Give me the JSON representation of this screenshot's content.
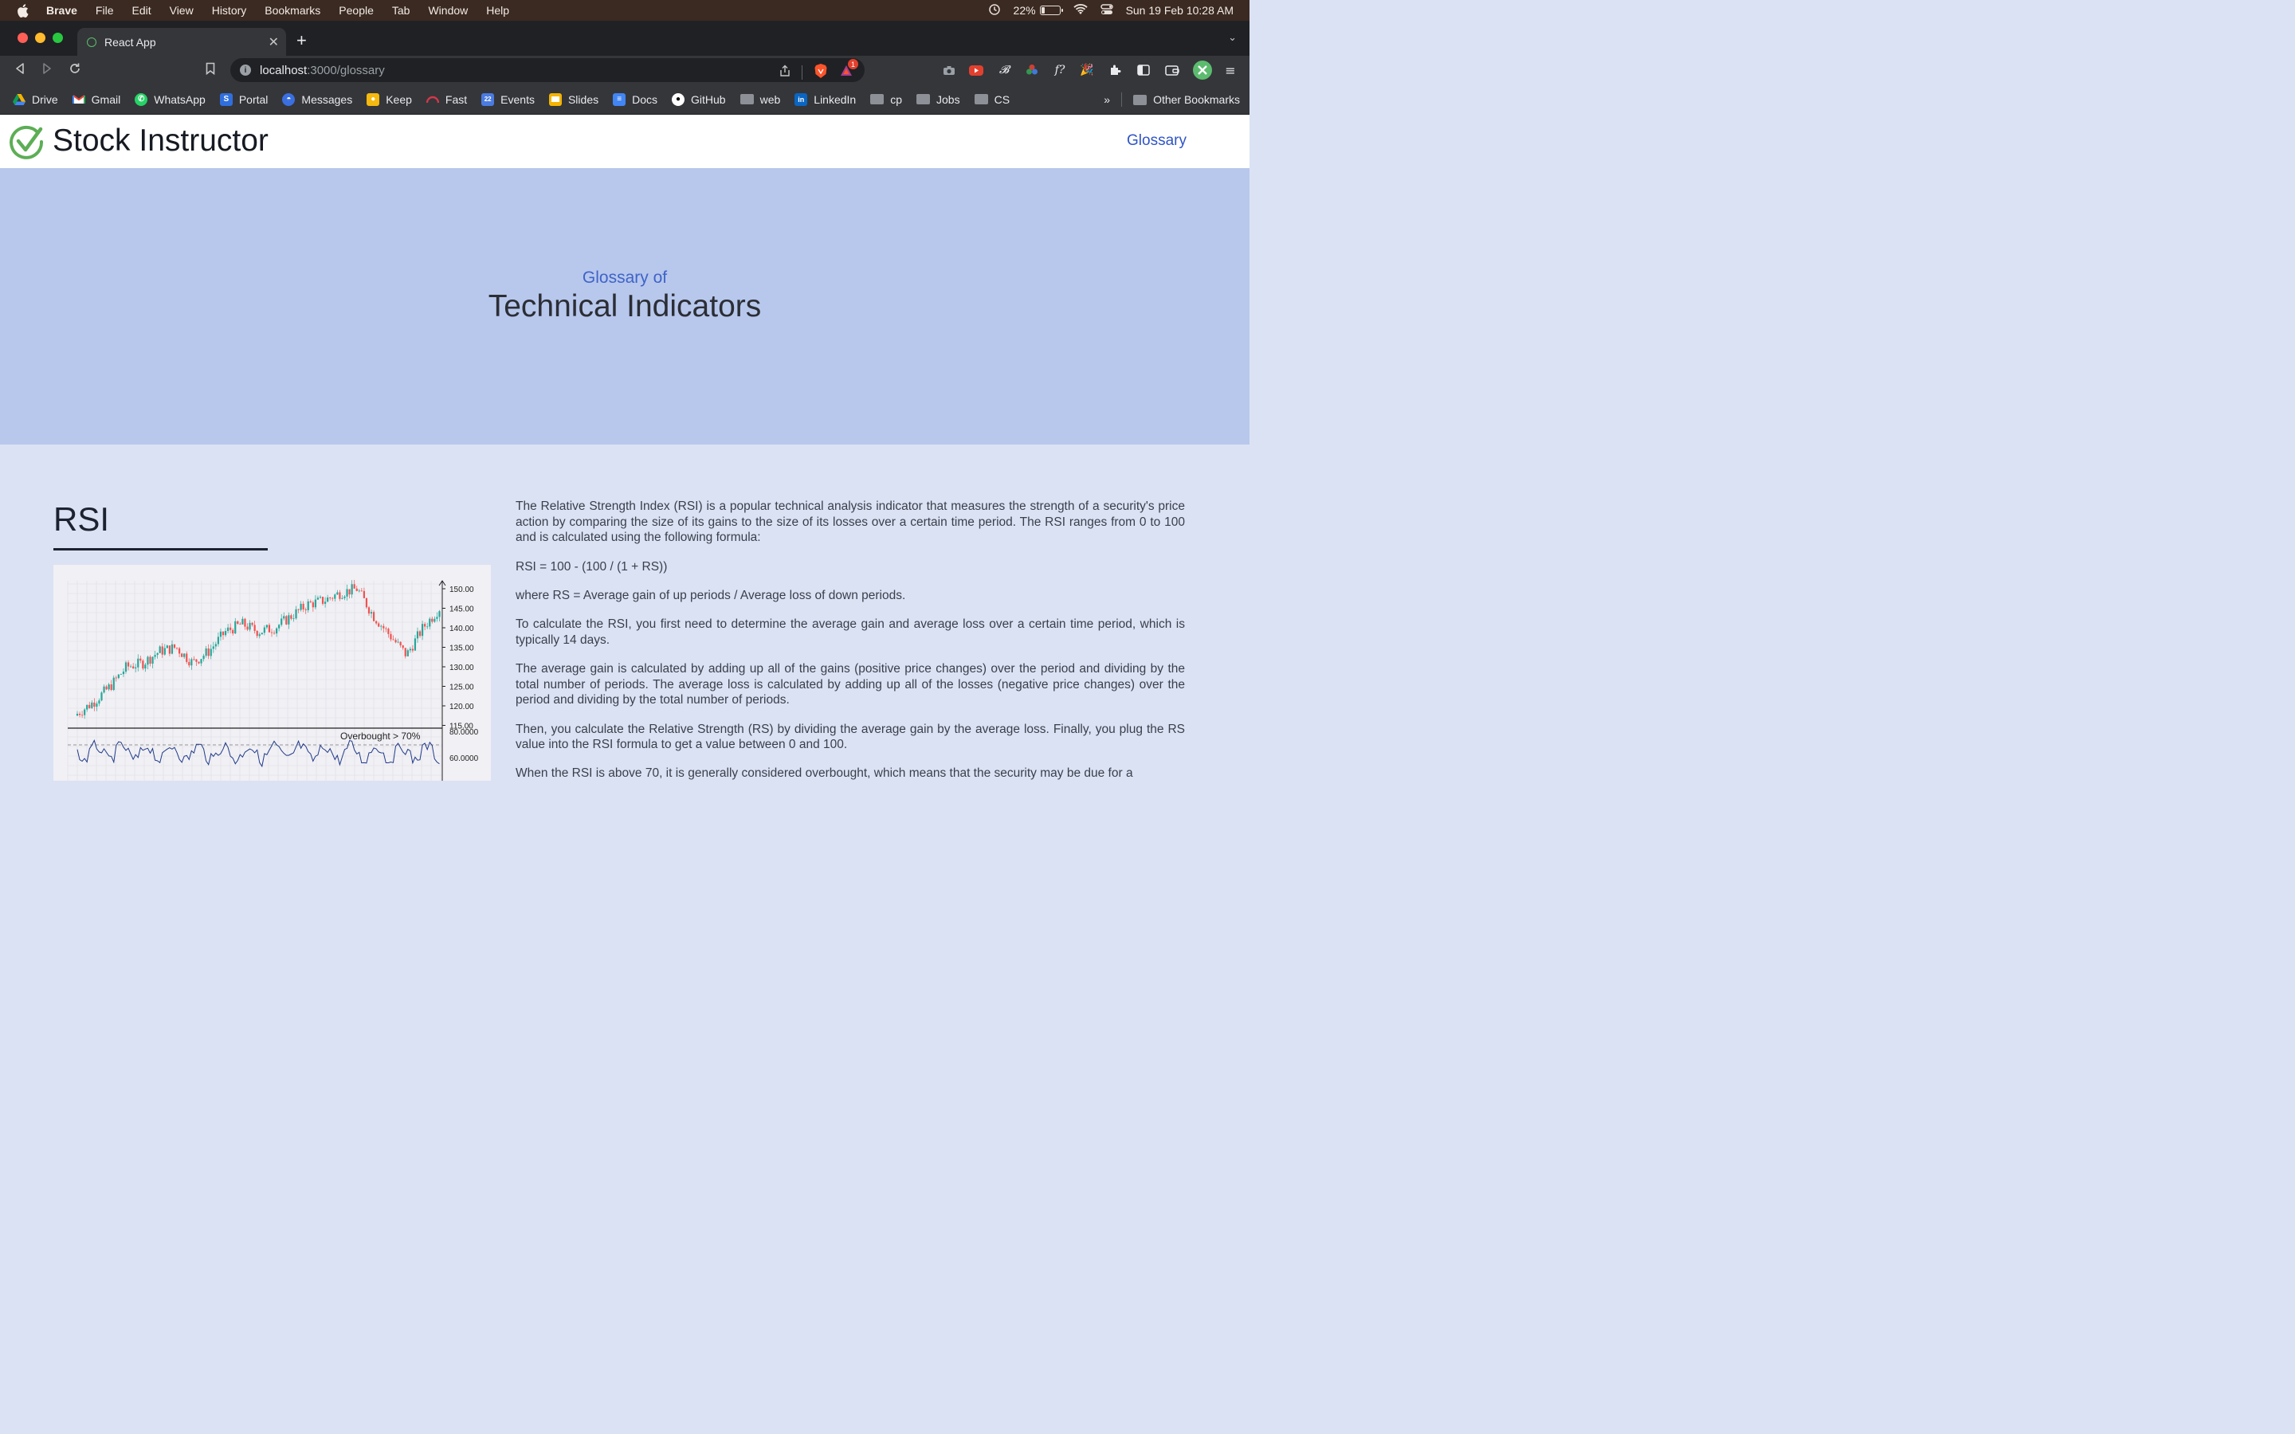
{
  "menubar": {
    "items": [
      "Brave",
      "File",
      "Edit",
      "View",
      "History",
      "Bookmarks",
      "People",
      "Tab",
      "Window",
      "Help"
    ],
    "battery_text": "22%",
    "battery_level": 0.22,
    "datetime": "Sun 19 Feb  10:28 AM",
    "icons": [
      "apple-icon",
      "time-machine-icon",
      "battery-icon",
      "wifi-icon",
      "control-center-icon"
    ]
  },
  "browser": {
    "tab_title": "React App",
    "url_host": "localhost",
    "url_path": ":3000/glossary",
    "shield_badge": "1",
    "bookmarks": [
      {
        "label": "Drive",
        "icon": "drive-icon",
        "color": "#f4b400"
      },
      {
        "label": "Gmail",
        "icon": "gmail-icon",
        "color": "#ea4335"
      },
      {
        "label": "WhatsApp",
        "icon": "whatsapp-icon",
        "color": "#25d366"
      },
      {
        "label": "Portal",
        "icon": "portal-icon",
        "color": "#2f6fde"
      },
      {
        "label": "Messages",
        "icon": "messages-icon",
        "color": "#3a6fe0"
      },
      {
        "label": "Keep",
        "icon": "keep-icon",
        "color": "#f5b90f"
      },
      {
        "label": "Fast",
        "icon": "fast-icon",
        "color": "#d2384a"
      },
      {
        "label": "Events",
        "icon": "calendar-icon",
        "color": "#4a7be0"
      },
      {
        "label": "Slides",
        "icon": "slides-icon",
        "color": "#f4b400"
      },
      {
        "label": "Docs",
        "icon": "docs-icon",
        "color": "#4285f4"
      },
      {
        "label": "GitHub",
        "icon": "github-icon",
        "color": "#ffffff"
      },
      {
        "label": "web",
        "icon": "folder-icon",
        "color": "#8d9096"
      },
      {
        "label": "LinkedIn",
        "icon": "linkedin-icon",
        "color": "#0a66c2"
      },
      {
        "label": "cp",
        "icon": "folder-icon",
        "color": "#8d9096"
      },
      {
        "label": "Jobs",
        "icon": "folder-icon",
        "color": "#8d9096"
      },
      {
        "label": "CS",
        "icon": "folder-icon",
        "color": "#8d9096"
      }
    ],
    "overflow": "»",
    "other_bookmarks": "Other Bookmarks"
  },
  "app": {
    "brand": "Stock Instructor",
    "nav_link": "Glossary",
    "hero_sub": "Glossary of",
    "hero_title": "Technical Indicators",
    "accent": "#2f54c4",
    "section": {
      "title": "RSI",
      "paragraphs": [
        "The Relative Strength Index (RSI) is a popular technical analysis indicator that measures the strength of a security's price action by comparing the size of its gains to the size of its losses over a certain time period. The RSI ranges from 0 to 100 and is calculated using the following formula:",
        "RSI = 100 - (100 / (1 + RS))",
        "where RS = Average gain of up periods / Average loss of down periods.",
        "To calculate the RSI, you first need to determine the average gain and average loss over a certain time period, which is typically 14 days.",
        "The average gain is calculated by adding up all of the gains (positive price changes) over the period and dividing by the total number of periods. The average loss is calculated by adding up all of the losses (negative price changes) over the period and dividing by the total number of periods.",
        "Then, you calculate the Relative Strength (RS) by dividing the average gain by the average loss. Finally, you plug the RS value into the RSI formula to get a value between 0 and 100.",
        "When the RSI is above 70, it is generally considered overbought, which means that the security may be due for a"
      ],
      "chart": {
        "price_ticks": [
          "150.00",
          "145.00",
          "140.00",
          "135.00",
          "130.00",
          "125.00",
          "120.00",
          "115.00"
        ],
        "rsi_ticks": [
          "80.0000",
          "60.0000"
        ],
        "annotation": "Overbought > 70%"
      }
    }
  }
}
